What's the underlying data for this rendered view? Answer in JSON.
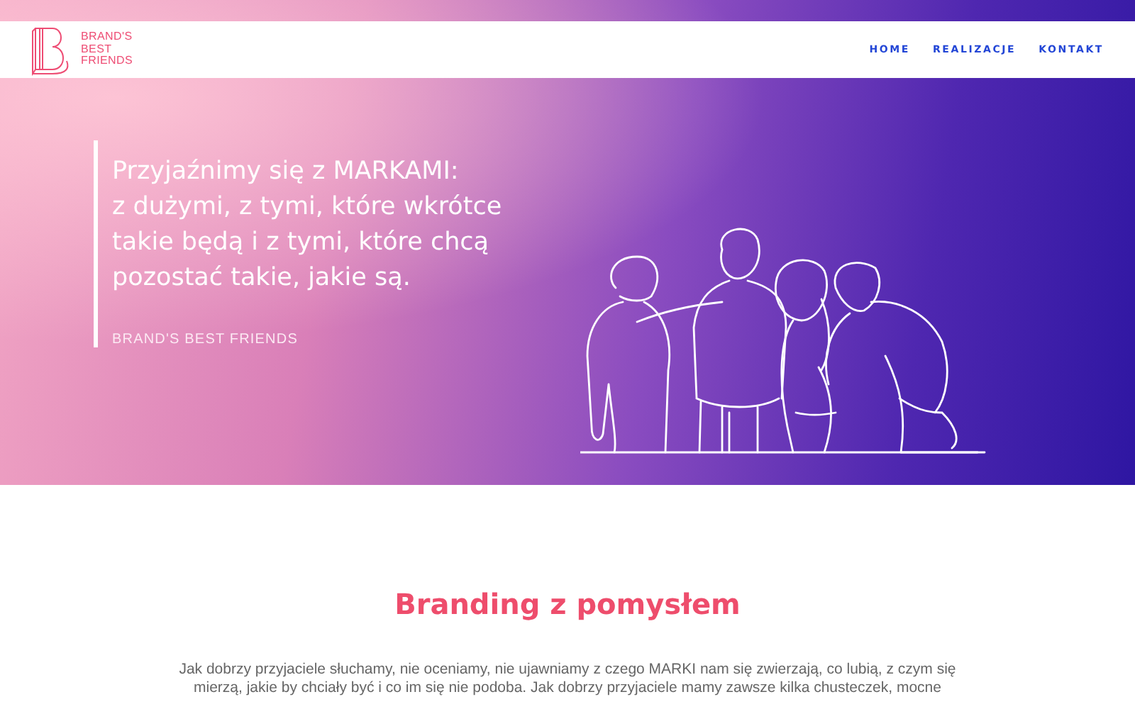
{
  "header": {
    "logo_lines": [
      "BRAND'S",
      "BEST",
      "FRIENDS"
    ],
    "nav": [
      "HOME",
      "REALIZACJE",
      "KONTAKT"
    ]
  },
  "hero": {
    "headline_lines": [
      "Przyjaźnimy się z MARKAMI:",
      "z dużymi, z tymi, które wkrótce",
      "takie będą i z tymi, które chcą",
      "pozostać takie, jakie są."
    ],
    "tagline": "BRAND'S BEST FRIENDS"
  },
  "section": {
    "title": "Branding z pomysłem",
    "paragraph_lines": [
      "Jak dobrzy przyjaciele słuchamy, nie oceniamy, nie ujawniamy z czego MARKI nam się  zwierzają, co lubią, z czym się",
      "mierzą, jakie by chciały być i co im się nie podoba. Jak dobrzy przyjaciele mamy zawsze kilka  chusteczek, mocne"
    ]
  }
}
